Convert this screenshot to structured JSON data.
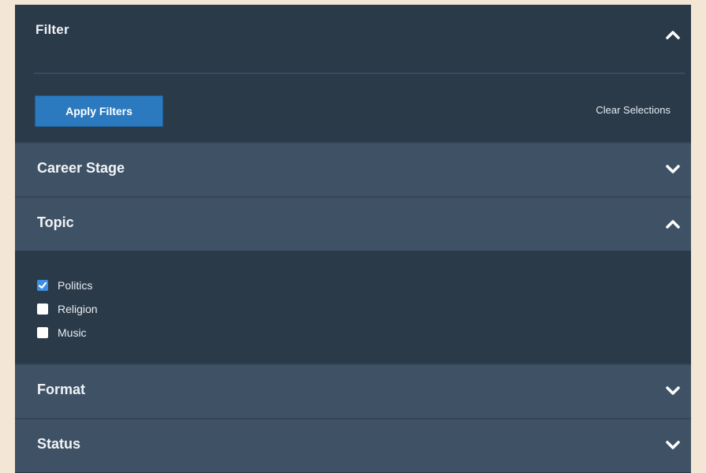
{
  "filter": {
    "title": "Filter",
    "apply_label": "Apply Filters",
    "clear_label": "Clear Selections"
  },
  "sections": [
    {
      "label": "Career Stage",
      "expanded": false
    },
    {
      "label": "Topic",
      "expanded": true
    },
    {
      "label": "Format",
      "expanded": false
    },
    {
      "label": "Status",
      "expanded": false
    }
  ],
  "topic_options": [
    {
      "label": "Politics",
      "checked": true
    },
    {
      "label": "Religion",
      "checked": false
    },
    {
      "label": "Music",
      "checked": false
    }
  ],
  "colors": {
    "panel_dark": "#2b3a49",
    "section_header": "#3f5265",
    "accent_button": "#2b7ac0",
    "checkbox_checked": "#3d8ee0",
    "page_background": "#f4e6d4"
  },
  "icons": {
    "expanded": "chevron-up-icon",
    "collapsed": "chevron-down-icon"
  }
}
